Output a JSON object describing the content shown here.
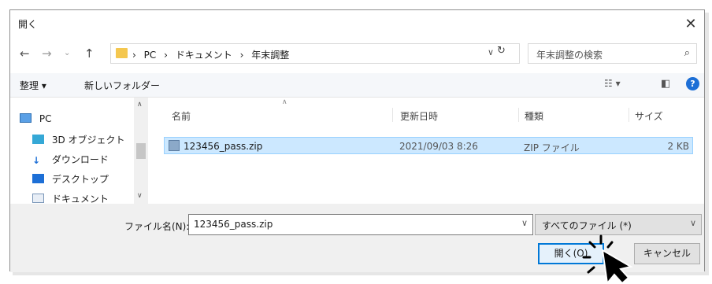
{
  "window": {
    "title": "開く",
    "close_glyph": "✕"
  },
  "address": {
    "breadcrumb": [
      "PC",
      "ドキュメント",
      "年末調整"
    ],
    "separator": "›",
    "search_placeholder": "年末調整の検索"
  },
  "toolbar": {
    "organize": "整理 ▾",
    "new_folder": "新しいフォルダー"
  },
  "nav_pane": {
    "items": [
      {
        "label": "PC",
        "icon": "pc-icon"
      },
      {
        "label": "3D オブジェクト",
        "icon": "3d-objects-icon"
      },
      {
        "label": "ダウンロード",
        "icon": "download-arrow-icon"
      },
      {
        "label": "デスクトップ",
        "icon": "desktop-icon"
      },
      {
        "label": "ドキュメント",
        "icon": "document-icon"
      }
    ]
  },
  "file_list": {
    "columns": [
      "名前",
      "更新日時",
      "種類",
      "サイズ"
    ],
    "rows": [
      {
        "name": "123456_pass.zip",
        "modified": "2021/09/03 8:26",
        "type": "ZIP ファイル",
        "size": "2 KB",
        "selected": true
      }
    ]
  },
  "bottom": {
    "filename_label": "ファイル名(N):",
    "filename_value": "123456_pass.zip",
    "filetype_value": "すべてのファイル (*)",
    "open_button": "開く(O)",
    "cancel_button": "キャンセル"
  },
  "colors": {
    "accent": "#0078d7",
    "selection": "#cce8ff",
    "folder": "#f4c74f"
  }
}
